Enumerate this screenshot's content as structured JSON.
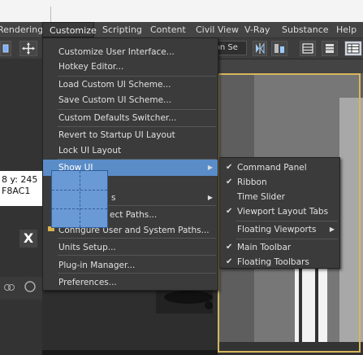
{
  "menubar": {
    "items": [
      {
        "label": "Rendering"
      },
      {
        "label": "Customize"
      },
      {
        "label": "Scripting"
      },
      {
        "label": "Content"
      },
      {
        "label": "Civil View"
      },
      {
        "label": "V-Ray"
      },
      {
        "label": "Substance"
      },
      {
        "label": "Help"
      }
    ]
  },
  "toolbar": {
    "selection_set": "ion Se"
  },
  "customize_menu": {
    "items": [
      {
        "label": "Customize User Interface..."
      },
      {
        "label": "Hotkey Editor..."
      },
      {
        "label": "Load Custom UI Scheme..."
      },
      {
        "label": "Save Custom UI Scheme..."
      },
      {
        "label": "Custom Defaults Switcher..."
      },
      {
        "label": "Revert to Startup UI Layout"
      },
      {
        "label": "Lock UI Layout"
      },
      {
        "label": "Show UI"
      },
      {
        "label": "s"
      },
      {
        "label": "ect Paths..."
      },
      {
        "label": "Configure User and System Paths..."
      },
      {
        "label": "Units Setup..."
      },
      {
        "label": "Plug-in Manager..."
      },
      {
        "label": "Preferences..."
      }
    ]
  },
  "show_ui_submenu": {
    "items": [
      {
        "label": "Command Panel",
        "checked": true
      },
      {
        "label": "Ribbon",
        "checked": true
      },
      {
        "label": "Time Slider",
        "checked": false
      },
      {
        "label": "Viewport Layout Tabs",
        "checked": true
      },
      {
        "label": "Floating Viewports",
        "checked": false
      },
      {
        "label": "Main Toolbar",
        "checked": true
      },
      {
        "label": "Floating Toolbars",
        "checked": true
      }
    ]
  },
  "coords": {
    "line1": "8  y: 245",
    "line2": "F8AC1"
  },
  "close_button": {
    "label": "X"
  },
  "colors": {
    "highlight": "#5a8cc8",
    "viewport_border": "#d7b75a"
  }
}
